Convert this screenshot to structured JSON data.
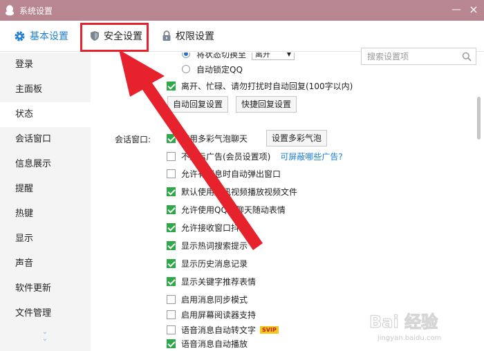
{
  "window": {
    "title": "系统设置",
    "minimize": "—",
    "close": "×"
  },
  "tabs": [
    {
      "label": "基本设置",
      "icon": "gear-icon",
      "active": true
    },
    {
      "label": "安全设置",
      "icon": "shield-icon",
      "active": false
    },
    {
      "label": "权限设置",
      "icon": "lock-icon",
      "active": false
    }
  ],
  "search": {
    "placeholder": "搜索设置项"
  },
  "sidebar": {
    "items": [
      "登录",
      "主面板",
      "状态",
      "会话窗口",
      "信息展示",
      "提醒",
      "热键",
      "显示",
      "声音",
      "软件更新",
      "文件管理"
    ],
    "active_index": 2
  },
  "content": {
    "status": {
      "switch_label": "将状态切换至",
      "switch_value": "离开",
      "auto_lock": "自动锁定QQ",
      "auto_reply": "离开、忙碌、请勿打扰时自动回复(100字以内)",
      "auto_reply_btn": "自动回复设置",
      "quick_reply_btn": "快捷回复设置"
    },
    "chat_window": {
      "label": "会话窗口:",
      "bubble_btn": "设置多彩气泡",
      "ads_link": "可屏蔽哪些广告?",
      "svip_badge": "SVIP",
      "options": [
        {
          "label": "使用多彩气泡聊天",
          "checked": true
        },
        {
          "label": "不显示广告(会员设置项)",
          "checked": false
        },
        {
          "label": "允许有消息时自动弹出窗口",
          "checked": false
        },
        {
          "label": "默认使用腾讯视频播放视频文件",
          "checked": true
        },
        {
          "label": "允许使用QQ秀聊天随动表情",
          "checked": true
        },
        {
          "label": "允许接收窗口抖动",
          "checked": true
        },
        {
          "label": "显示热词搜索提示",
          "checked": true
        },
        {
          "label": "显示历史消息记录",
          "checked": true
        },
        {
          "label": "显示关键字推荐表情",
          "checked": true
        },
        {
          "label": "启用消息同步模式",
          "checked": false
        },
        {
          "label": "启用屏幕阅读器支持",
          "checked": false
        },
        {
          "label": "语音消息自动转文字",
          "checked": false
        },
        {
          "label": "语音消息自动播放",
          "checked": true
        }
      ]
    }
  },
  "watermark": {
    "text": "jingyan.baidu.com",
    "logo_text": "Bai 经验"
  },
  "colors": {
    "titlebar": "#b88690",
    "accent": "#1f7fd2",
    "check": "#2fa84a",
    "highlight": "#e6222c"
  }
}
